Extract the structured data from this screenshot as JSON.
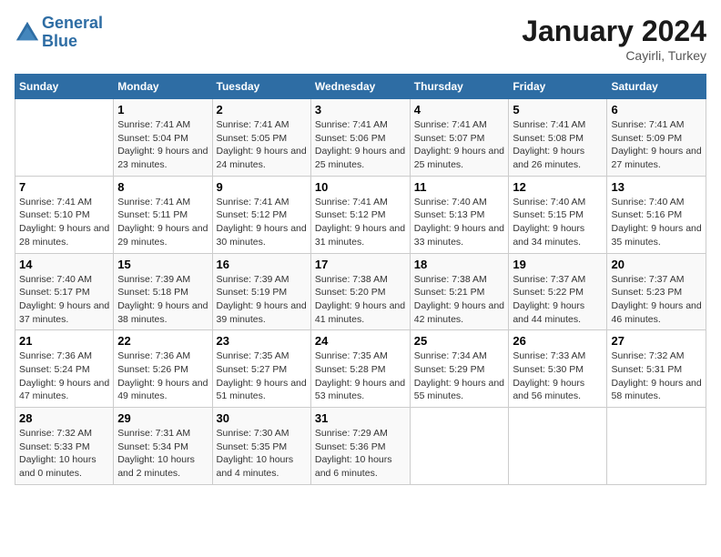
{
  "header": {
    "logo_line1": "General",
    "logo_line2": "Blue",
    "month_year": "January 2024",
    "location": "Cayirli, Turkey"
  },
  "columns": [
    "Sunday",
    "Monday",
    "Tuesday",
    "Wednesday",
    "Thursday",
    "Friday",
    "Saturday"
  ],
  "weeks": [
    [
      {
        "day": "",
        "sunrise": "",
        "sunset": "",
        "daylight": ""
      },
      {
        "day": "1",
        "sunrise": "Sunrise: 7:41 AM",
        "sunset": "Sunset: 5:04 PM",
        "daylight": "Daylight: 9 hours and 23 minutes."
      },
      {
        "day": "2",
        "sunrise": "Sunrise: 7:41 AM",
        "sunset": "Sunset: 5:05 PM",
        "daylight": "Daylight: 9 hours and 24 minutes."
      },
      {
        "day": "3",
        "sunrise": "Sunrise: 7:41 AM",
        "sunset": "Sunset: 5:06 PM",
        "daylight": "Daylight: 9 hours and 25 minutes."
      },
      {
        "day": "4",
        "sunrise": "Sunrise: 7:41 AM",
        "sunset": "Sunset: 5:07 PM",
        "daylight": "Daylight: 9 hours and 25 minutes."
      },
      {
        "day": "5",
        "sunrise": "Sunrise: 7:41 AM",
        "sunset": "Sunset: 5:08 PM",
        "daylight": "Daylight: 9 hours and 26 minutes."
      },
      {
        "day": "6",
        "sunrise": "Sunrise: 7:41 AM",
        "sunset": "Sunset: 5:09 PM",
        "daylight": "Daylight: 9 hours and 27 minutes."
      }
    ],
    [
      {
        "day": "7",
        "sunrise": "Sunrise: 7:41 AM",
        "sunset": "Sunset: 5:10 PM",
        "daylight": "Daylight: 9 hours and 28 minutes."
      },
      {
        "day": "8",
        "sunrise": "Sunrise: 7:41 AM",
        "sunset": "Sunset: 5:11 PM",
        "daylight": "Daylight: 9 hours and 29 minutes."
      },
      {
        "day": "9",
        "sunrise": "Sunrise: 7:41 AM",
        "sunset": "Sunset: 5:12 PM",
        "daylight": "Daylight: 9 hours and 30 minutes."
      },
      {
        "day": "10",
        "sunrise": "Sunrise: 7:41 AM",
        "sunset": "Sunset: 5:12 PM",
        "daylight": "Daylight: 9 hours and 31 minutes."
      },
      {
        "day": "11",
        "sunrise": "Sunrise: 7:40 AM",
        "sunset": "Sunset: 5:13 PM",
        "daylight": "Daylight: 9 hours and 33 minutes."
      },
      {
        "day": "12",
        "sunrise": "Sunrise: 7:40 AM",
        "sunset": "Sunset: 5:15 PM",
        "daylight": "Daylight: 9 hours and 34 minutes."
      },
      {
        "day": "13",
        "sunrise": "Sunrise: 7:40 AM",
        "sunset": "Sunset: 5:16 PM",
        "daylight": "Daylight: 9 hours and 35 minutes."
      }
    ],
    [
      {
        "day": "14",
        "sunrise": "Sunrise: 7:40 AM",
        "sunset": "Sunset: 5:17 PM",
        "daylight": "Daylight: 9 hours and 37 minutes."
      },
      {
        "day": "15",
        "sunrise": "Sunrise: 7:39 AM",
        "sunset": "Sunset: 5:18 PM",
        "daylight": "Daylight: 9 hours and 38 minutes."
      },
      {
        "day": "16",
        "sunrise": "Sunrise: 7:39 AM",
        "sunset": "Sunset: 5:19 PM",
        "daylight": "Daylight: 9 hours and 39 minutes."
      },
      {
        "day": "17",
        "sunrise": "Sunrise: 7:38 AM",
        "sunset": "Sunset: 5:20 PM",
        "daylight": "Daylight: 9 hours and 41 minutes."
      },
      {
        "day": "18",
        "sunrise": "Sunrise: 7:38 AM",
        "sunset": "Sunset: 5:21 PM",
        "daylight": "Daylight: 9 hours and 42 minutes."
      },
      {
        "day": "19",
        "sunrise": "Sunrise: 7:37 AM",
        "sunset": "Sunset: 5:22 PM",
        "daylight": "Daylight: 9 hours and 44 minutes."
      },
      {
        "day": "20",
        "sunrise": "Sunrise: 7:37 AM",
        "sunset": "Sunset: 5:23 PM",
        "daylight": "Daylight: 9 hours and 46 minutes."
      }
    ],
    [
      {
        "day": "21",
        "sunrise": "Sunrise: 7:36 AM",
        "sunset": "Sunset: 5:24 PM",
        "daylight": "Daylight: 9 hours and 47 minutes."
      },
      {
        "day": "22",
        "sunrise": "Sunrise: 7:36 AM",
        "sunset": "Sunset: 5:26 PM",
        "daylight": "Daylight: 9 hours and 49 minutes."
      },
      {
        "day": "23",
        "sunrise": "Sunrise: 7:35 AM",
        "sunset": "Sunset: 5:27 PM",
        "daylight": "Daylight: 9 hours and 51 minutes."
      },
      {
        "day": "24",
        "sunrise": "Sunrise: 7:35 AM",
        "sunset": "Sunset: 5:28 PM",
        "daylight": "Daylight: 9 hours and 53 minutes."
      },
      {
        "day": "25",
        "sunrise": "Sunrise: 7:34 AM",
        "sunset": "Sunset: 5:29 PM",
        "daylight": "Daylight: 9 hours and 55 minutes."
      },
      {
        "day": "26",
        "sunrise": "Sunrise: 7:33 AM",
        "sunset": "Sunset: 5:30 PM",
        "daylight": "Daylight: 9 hours and 56 minutes."
      },
      {
        "day": "27",
        "sunrise": "Sunrise: 7:32 AM",
        "sunset": "Sunset: 5:31 PM",
        "daylight": "Daylight: 9 hours and 58 minutes."
      }
    ],
    [
      {
        "day": "28",
        "sunrise": "Sunrise: 7:32 AM",
        "sunset": "Sunset: 5:33 PM",
        "daylight": "Daylight: 10 hours and 0 minutes."
      },
      {
        "day": "29",
        "sunrise": "Sunrise: 7:31 AM",
        "sunset": "Sunset: 5:34 PM",
        "daylight": "Daylight: 10 hours and 2 minutes."
      },
      {
        "day": "30",
        "sunrise": "Sunrise: 7:30 AM",
        "sunset": "Sunset: 5:35 PM",
        "daylight": "Daylight: 10 hours and 4 minutes."
      },
      {
        "day": "31",
        "sunrise": "Sunrise: 7:29 AM",
        "sunset": "Sunset: 5:36 PM",
        "daylight": "Daylight: 10 hours and 6 minutes."
      },
      {
        "day": "",
        "sunrise": "",
        "sunset": "",
        "daylight": ""
      },
      {
        "day": "",
        "sunrise": "",
        "sunset": "",
        "daylight": ""
      },
      {
        "day": "",
        "sunrise": "",
        "sunset": "",
        "daylight": ""
      }
    ]
  ]
}
